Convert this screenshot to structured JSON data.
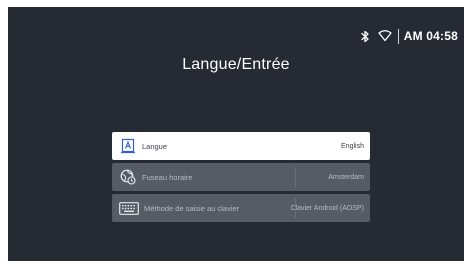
{
  "status_bar": {
    "bluetooth_icon": "bluetooth-icon",
    "wifi_icon": "wifi-icon",
    "clock": "AM 04:58"
  },
  "page": {
    "title": "Langue/Entrée"
  },
  "menu": {
    "items": [
      {
        "icon": "language-icon",
        "label": "Langue",
        "value": "English",
        "selected": true
      },
      {
        "icon": "timezone-icon",
        "label": "Fuseau horaire",
        "value": "Amsterdam",
        "selected": false
      },
      {
        "icon": "keyboard-icon",
        "label": "Méthode de saisie au clavier",
        "value": "Clavier Android (AOSP)",
        "selected": false
      }
    ]
  },
  "colors": {
    "background": "#262a32",
    "selected_item": "#ffffff",
    "item": "#575b63",
    "icon_accent": "#2f5fd1"
  }
}
